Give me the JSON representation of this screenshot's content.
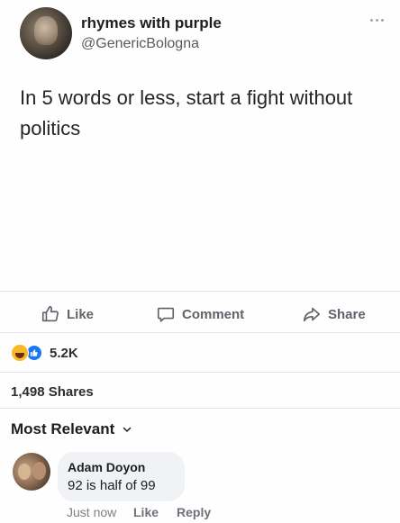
{
  "post": {
    "author_name": "rhymes with purple",
    "author_handle": "@GenericBologna",
    "text": "In 5 words or less, start a fight without politics"
  },
  "actions": {
    "like_label": "Like",
    "comment_label": "Comment",
    "share_label": "Share"
  },
  "reactions": {
    "count": "5.2K",
    "icons": [
      "haha-emoji-icon",
      "like-emoji-icon"
    ]
  },
  "shares": {
    "label": "1,498 Shares"
  },
  "comments_sort": {
    "label": "Most Relevant"
  },
  "comment": {
    "author": "Adam Doyon",
    "text": "92 is half of 99",
    "time": "Just now",
    "like_label": "Like",
    "reply_label": "Reply"
  },
  "colors": {
    "accent_blue": "#1877f2",
    "muted_text": "#5f646b",
    "bubble_bg": "#f0f2f5"
  }
}
